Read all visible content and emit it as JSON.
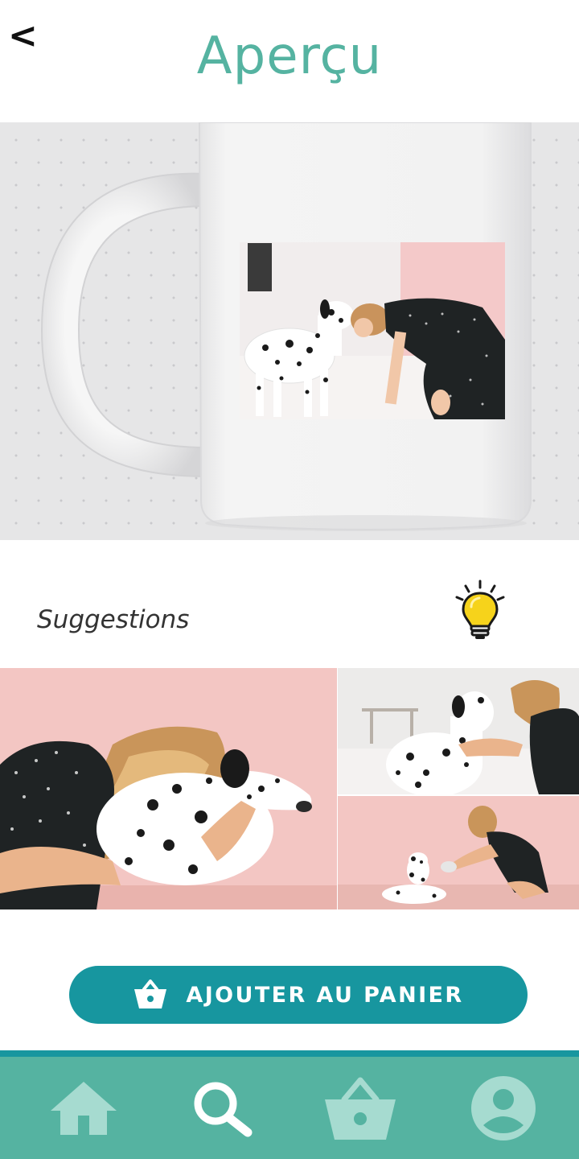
{
  "header": {
    "back_label": "<",
    "title": "Aperçu"
  },
  "preview": {
    "product": "mug",
    "photo": "woman-and-dalmatian"
  },
  "suggestions": {
    "label": "Suggestions",
    "icon": "lightbulb-icon"
  },
  "gallery": [
    {
      "photo": "woman-hugging-dalmatian"
    },
    {
      "photo": "woman-petting-dalmatian"
    },
    {
      "photo": "woman-feeding-dalmatian"
    }
  ],
  "cart_button": {
    "label": "AJOUTER AU PANIER",
    "icon": "basket-icon"
  },
  "bottom_nav": {
    "items": [
      {
        "icon": "home-icon"
      },
      {
        "icon": "search-icon",
        "active": true
      },
      {
        "icon": "basket-icon"
      },
      {
        "icon": "profile-icon"
      }
    ]
  },
  "colors": {
    "title": "#55b3a1",
    "button": "#17969f",
    "nav_bar": "#55b3a1",
    "nav_icon": "#a6dbd0",
    "nav_icon_active": "#ffffff",
    "bulb": "#f6d31b"
  }
}
